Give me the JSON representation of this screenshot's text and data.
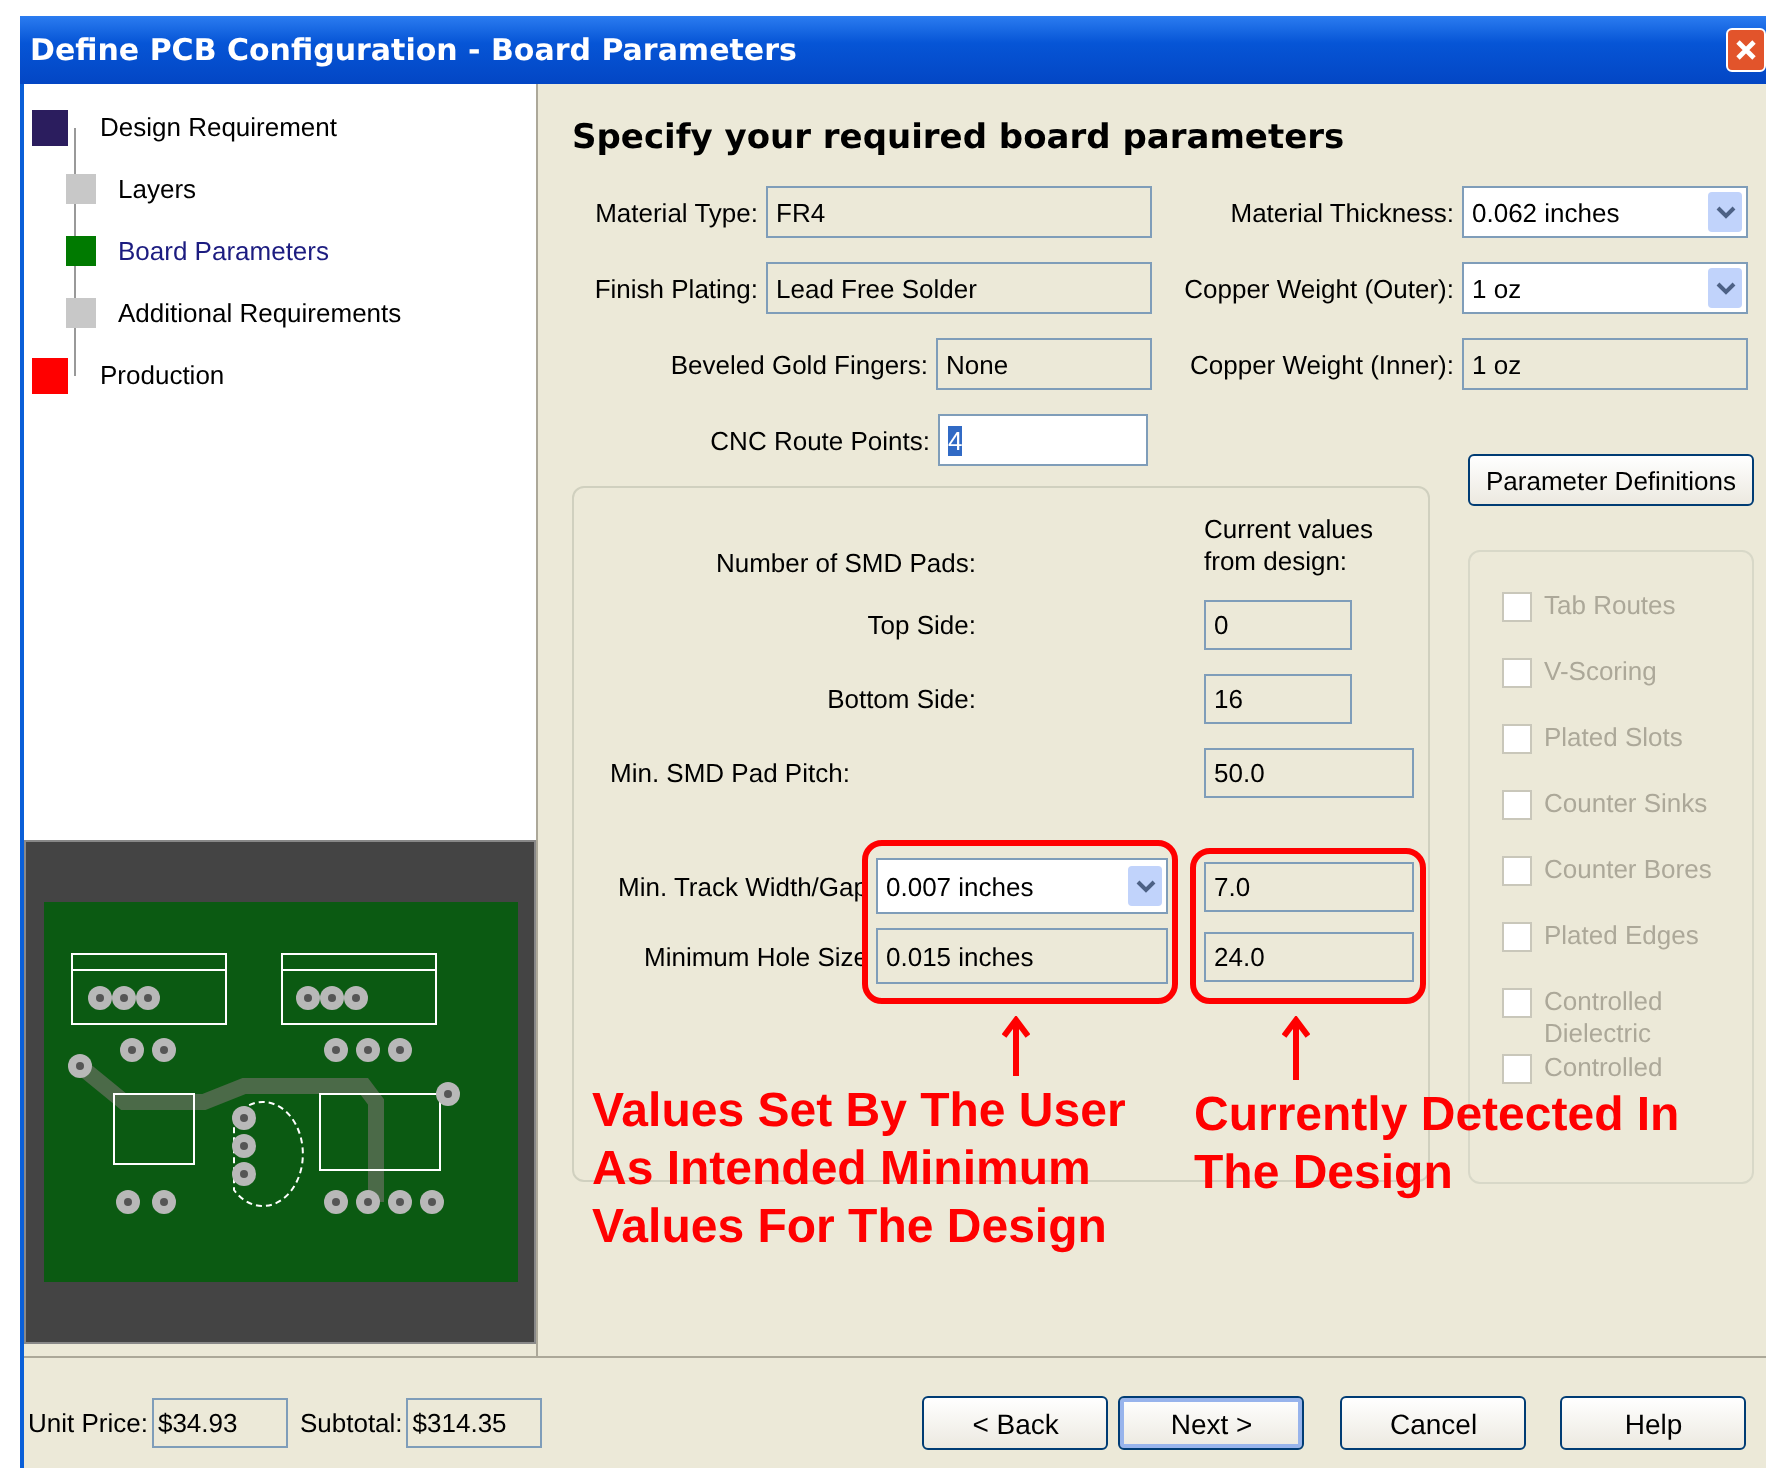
{
  "window": {
    "title": "Define PCB Configuration - Board Parameters"
  },
  "steps": [
    {
      "label": "Design Requirement",
      "color": "#2b1d5e",
      "selected": false,
      "children": [
        {
          "label": "Layers",
          "color": "#c8c8c8",
          "selected": false
        },
        {
          "label": "Board Parameters",
          "color": "#007a00",
          "selected": true
        },
        {
          "label": "Additional Requirements",
          "color": "#c8c8c8",
          "selected": false
        }
      ]
    },
    {
      "label": "Production",
      "color": "#ff0000",
      "selected": false
    }
  ],
  "heading": "Specify your required board parameters",
  "field_rows": [
    [
      {
        "label": "Material Type:",
        "value": "FR4",
        "kind": "readonly"
      },
      {
        "label": "Material Thickness:",
        "value": "0.062 inches",
        "kind": "dropdown"
      }
    ],
    [
      {
        "label": "Finish Plating:",
        "value": "Lead Free Solder",
        "kind": "readonly"
      },
      {
        "label": "Copper Weight (Outer):",
        "value": "1 oz",
        "kind": "dropdown"
      }
    ],
    [
      {
        "label": "Beveled Gold Fingers:",
        "value": "None",
        "kind": "readonly"
      },
      {
        "label": "Copper Weight (Inner):",
        "value": "1 oz",
        "kind": "readonly"
      }
    ]
  ],
  "cnc": {
    "label": "CNC Route Points:",
    "value": "4",
    "highlighted": true
  },
  "definitions_button": "Parameter Definitions",
  "smd": {
    "current_heading": "Current values from design:",
    "rows": [
      {
        "label": "Number of SMD Pads:",
        "kind": "heading"
      },
      {
        "label": "Top Side:",
        "kind": "count",
        "current": "0"
      },
      {
        "label": "Bottom Side:",
        "kind": "count",
        "current": "16"
      },
      {
        "label": "Min. SMD Pad Pitch:",
        "kind": "pitch",
        "current": "50.0"
      },
      {
        "label": "Min. Track Width/Gap",
        "kind": "dropdown",
        "value": "0.007 inches",
        "current": "7.0"
      },
      {
        "label": "Minimum Hole Size",
        "kind": "readonly",
        "value": "0.015 inches",
        "current": "24.0"
      }
    ]
  },
  "options": [
    {
      "label": "Tab Routes",
      "checked": false,
      "disabled": true
    },
    {
      "label": "V-Scoring",
      "checked": false,
      "disabled": true
    },
    {
      "label": "Plated Slots",
      "checked": false,
      "disabled": true
    },
    {
      "label": "Counter Sinks",
      "checked": false,
      "disabled": true
    },
    {
      "label": "Counter Bores",
      "checked": false,
      "disabled": true
    },
    {
      "label": "Plated Edges",
      "checked": false,
      "disabled": true
    },
    {
      "label": "Controlled Dielectric",
      "checked": false,
      "disabled": true
    },
    {
      "label": "Controlled",
      "checked": false,
      "disabled": true
    }
  ],
  "annotations": [
    {
      "lines": [
        "Values Set By The User",
        "As Intended Minimum",
        "Values For The Design"
      ]
    },
    {
      "lines": [
        "Currently Detected In",
        "The Design"
      ]
    }
  ],
  "footer": {
    "unit_price_label": "Unit Price:",
    "unit_price": "$34.93",
    "subtotal_label": "Subtotal:",
    "subtotal": "$314.35"
  },
  "buttons": [
    {
      "label": "< Back",
      "default": false
    },
    {
      "label": "Next >",
      "default": true
    },
    {
      "label": "Cancel",
      "default": false
    },
    {
      "label": "Help",
      "default": false
    }
  ]
}
